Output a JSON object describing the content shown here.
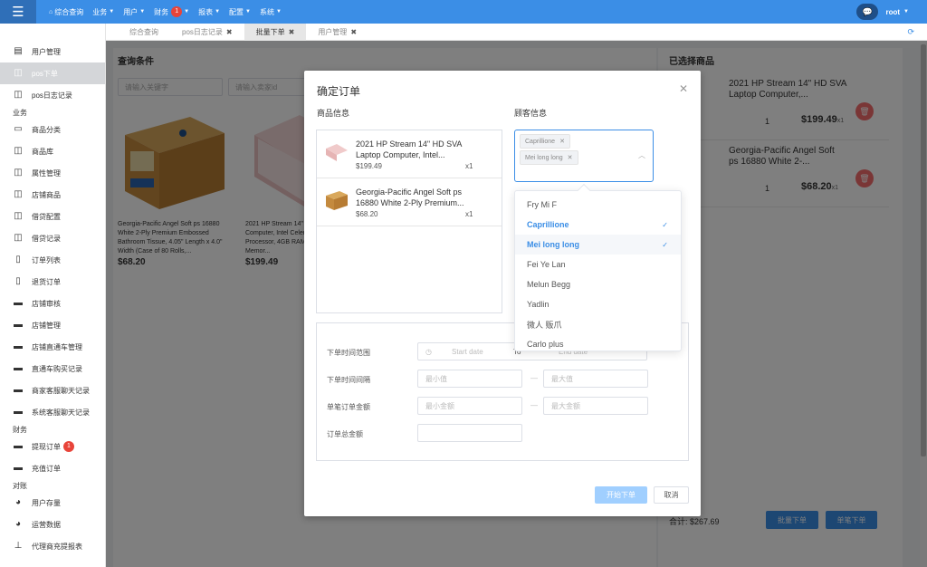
{
  "topbar": {
    "nav": [
      {
        "label": "综合查询",
        "icon": "home-icon",
        "caret": false
      },
      {
        "label": "业务",
        "caret": true
      },
      {
        "label": "用户",
        "caret": true
      },
      {
        "label": "财务",
        "caret": true,
        "badge": "1"
      },
      {
        "label": "报表",
        "caret": true
      },
      {
        "label": "配置",
        "caret": true
      },
      {
        "label": "系统",
        "caret": true
      }
    ],
    "user": "root",
    "accent": "#3b8ee6"
  },
  "sidebar": {
    "items": [
      {
        "label": "用户管理",
        "icon": "document-icon"
      },
      {
        "label": "pos下单",
        "icon": "columns-icon",
        "active": true
      },
      {
        "label": "pos日志记录",
        "icon": "columns-icon"
      },
      {
        "group": "业务"
      },
      {
        "label": "商品分类",
        "icon": "laptop-icon"
      },
      {
        "label": "商品库",
        "icon": "columns-icon"
      },
      {
        "label": "属性管理",
        "icon": "columns-icon"
      },
      {
        "label": "店铺商品",
        "icon": "columns-icon"
      },
      {
        "label": "借贷配置",
        "icon": "columns-icon"
      },
      {
        "label": "借贷记录",
        "icon": "columns-icon"
      },
      {
        "label": "订单列表",
        "icon": "file-icon"
      },
      {
        "label": "退货订单",
        "icon": "file-icon"
      },
      {
        "label": "店铺审核",
        "icon": "card-icon"
      },
      {
        "label": "店铺管理",
        "icon": "card-icon"
      },
      {
        "label": "店铺直通车管理",
        "icon": "card-icon"
      },
      {
        "label": "直通车购买记录",
        "icon": "card-icon"
      },
      {
        "label": "商家客服聊天记录",
        "icon": "card-icon"
      },
      {
        "label": "系统客服聊天记录",
        "icon": "card-icon"
      },
      {
        "group": "财务"
      },
      {
        "label": "提现订单",
        "icon": "card-icon",
        "badge": "1"
      },
      {
        "label": "充值订单",
        "icon": "card-icon"
      },
      {
        "group": "对账"
      },
      {
        "label": "用户存量",
        "icon": "pie-icon"
      },
      {
        "label": "运营数据",
        "icon": "pie-icon"
      },
      {
        "label": "代理商充提报表",
        "icon": "org-chart-icon"
      }
    ]
  },
  "tabs": [
    {
      "label": "综合查询",
      "closable": false
    },
    {
      "label": "pos日志记录",
      "closable": true
    },
    {
      "label": "批量下单",
      "closable": true,
      "active": true
    },
    {
      "label": "用户管理",
      "closable": true
    }
  ],
  "background": {
    "query_title": "查询条件",
    "keyword_placeholder": "请输入关键字",
    "seller_placeholder": "请输入卖家id",
    "cards": [
      {
        "desc": "Georgia-Pacific Angel Soft ps 16880 White 2-Ply Premium Embossed Bathroom Tissue, 4.05\" Length x 4.0\" Width (Case of 80 Rolls,...",
        "price": "$68.20"
      },
      {
        "desc": "2021 HP Stream 14\" HD SVA Laptop Computer, Intel Celeron N4000 Processor, 4GB RAM, 64GB eMMC Flash Memor...",
        "price": "$199.49"
      }
    ],
    "selected_title": "已选择商品",
    "selected": [
      {
        "name": "2021 HP Stream 14\" HD SVA Laptop Computer,...",
        "qty": "1",
        "price": "$199.49",
        "unit": "x1"
      },
      {
        "name": "Georgia-Pacific Angel Soft ps 16880 White 2-...",
        "qty": "1",
        "price": "$68.20",
        "unit": "x1"
      }
    ],
    "total": "合计: $267.69",
    "batch_btn": "批量下单",
    "single_btn": "单笔下单"
  },
  "dialog": {
    "title": "确定订单",
    "goods_label": "商品信息",
    "customer_label": "顾客信息",
    "goods": [
      {
        "name": "2021 HP Stream 14\" HD SVA Laptop Computer, Intel...",
        "price": "$199.49",
        "qty": "x1"
      },
      {
        "name": "Georgia-Pacific Angel Soft ps 16880 White 2-Ply Premium...",
        "price": "$68.20",
        "qty": "x1"
      }
    ],
    "tags": [
      "Caprillione",
      "Mei long long"
    ],
    "dropdown": [
      {
        "label": "Fry Mi F",
        "selected": false
      },
      {
        "label": "Caprillione",
        "selected": true
      },
      {
        "label": "Mei long long",
        "selected": true,
        "hover": true
      },
      {
        "label": "Fei Ye Lan",
        "selected": false
      },
      {
        "label": "Melun Begg",
        "selected": false
      },
      {
        "label": "Yadlin",
        "selected": false
      },
      {
        "label": "微人 贩爪",
        "selected": false
      },
      {
        "label": "Carlo plus",
        "selected": false
      }
    ],
    "filters": {
      "time_range_label": "下单时间范围",
      "start_placeholder": "Start date",
      "to": "To",
      "end_placeholder": "End date",
      "interval_label": "下单时间间隔",
      "amount_label": "单笔订单金额",
      "total_label": "订单总金额",
      "min_value": "最小值",
      "max_value": "最大值",
      "min_amount": "最小金额",
      "max_amount": "最大金额"
    },
    "start_btn": "开始下单",
    "cancel_btn": "取消"
  }
}
